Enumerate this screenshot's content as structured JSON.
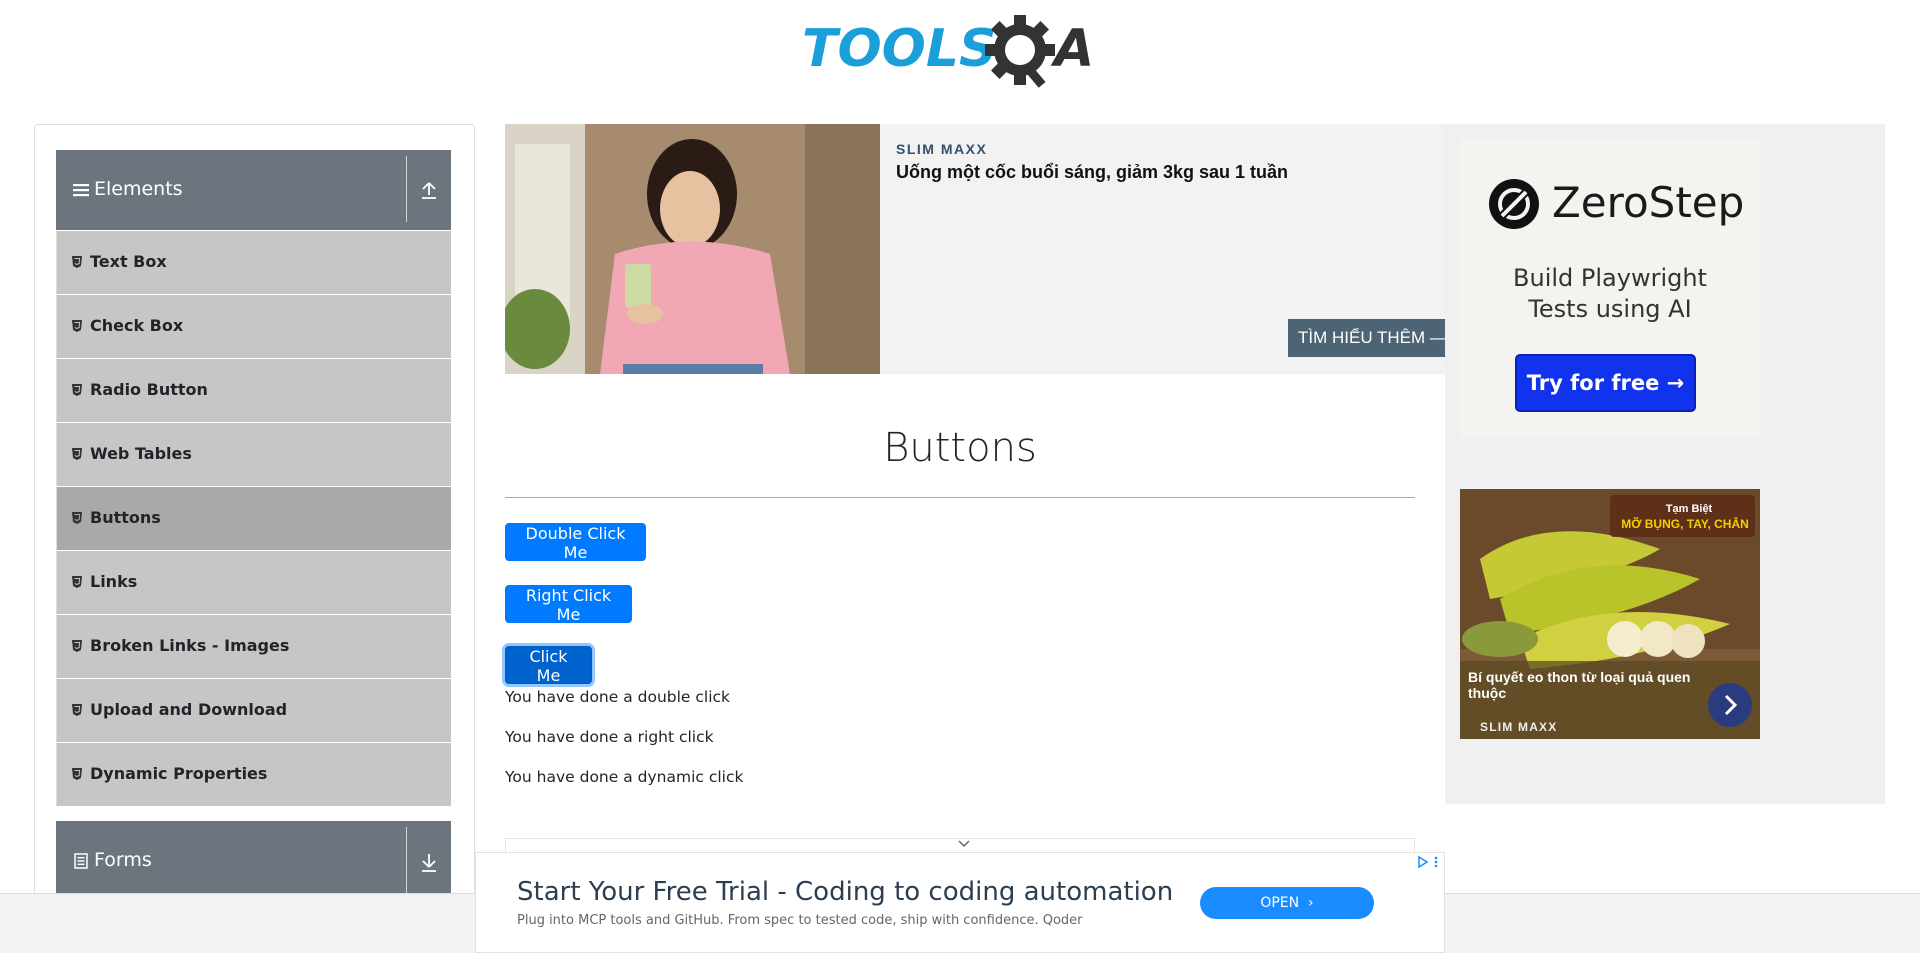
{
  "header": {
    "logo_text_left": "TOOLS",
    "logo_text_right": "A"
  },
  "sidebar": {
    "elements_group": {
      "label": "Elements"
    },
    "items": [
      {
        "label": "Text Box"
      },
      {
        "label": "Check Box"
      },
      {
        "label": "Radio Button"
      },
      {
        "label": "Web Tables"
      },
      {
        "label": "Buttons",
        "active": true
      },
      {
        "label": "Links"
      },
      {
        "label": "Broken Links - Images"
      },
      {
        "label": "Upload and Download"
      },
      {
        "label": "Dynamic Properties"
      }
    ],
    "forms_group": {
      "label": "Forms"
    }
  },
  "top_ad": {
    "brand": "SLIM MAXX",
    "headline": "Uống một cốc buổi sáng, giảm 3kg sau 1 tuần",
    "cta": "TÌM HIỂU THÊM —"
  },
  "main": {
    "title": "Buttons",
    "double_click_label": "Double Click Me",
    "right_click_label": "Right Click Me",
    "click_label": "Click Me",
    "messages": {
      "double": "You have done a double click",
      "right": "You have done a right click",
      "dynamic": "You have done a dynamic click"
    }
  },
  "right_ad": {
    "zerostep": {
      "name": "ZeroStep",
      "tagline_line1": "Build Playwright",
      "tagline_line2": "Tests using AI",
      "cta": "Try for free →"
    },
    "banana": {
      "tag_line1": "Tạm Biệt",
      "tag_line2": "MỠ BỤNG, TAY, CHÂN",
      "caption": "Bí quyết eo thon từ loại quả quen thuộc",
      "brand": "SLIM MAXX"
    }
  },
  "bottom_ad": {
    "title": "Start Your Free Trial - Coding to coding automation",
    "description": "Plug into MCP tools and GitHub. From spec to tested code, ship with confidence. Qoder",
    "open_label": "OPEN"
  },
  "colors": {
    "primary": "#007bff",
    "sidebar_header": "#6c757d",
    "menu_item": "#c6c6c6",
    "menu_item_active": "#a9a9a9",
    "logo_blue": "#1a9fdb",
    "logo_dark": "#333333"
  }
}
